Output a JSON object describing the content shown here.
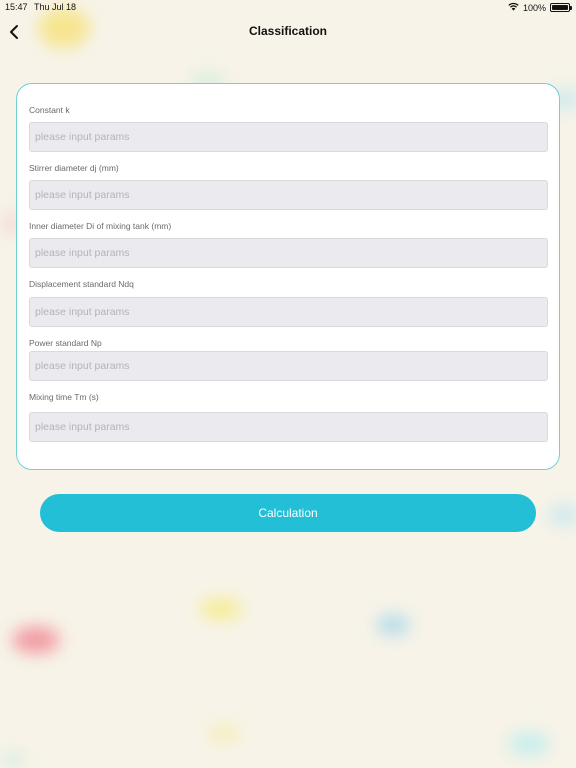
{
  "status_bar": {
    "time": "15:47",
    "date": "Thu Jul 18",
    "battery": "100%",
    "battery_level": 1.0
  },
  "nav": {
    "title": "Classification",
    "back_icon": "chevron-left-icon"
  },
  "form": {
    "fields": [
      {
        "label": "Constant k",
        "placeholder": "please input params",
        "value": ""
      },
      {
        "label": "Stirrer diameter dj (mm)",
        "placeholder": "please input params",
        "value": ""
      },
      {
        "label": "Inner diameter Di of mixing tank (mm)",
        "placeholder": "please input params",
        "value": ""
      },
      {
        "label": "Displacement standard Ndq",
        "placeholder": "please input params",
        "value": ""
      },
      {
        "label": "Power standard Np",
        "placeholder": "please input params",
        "value": ""
      },
      {
        "label": "Mixing time Tm (s)",
        "placeholder": "please input params",
        "value": ""
      }
    ],
    "submit_label": "Calculation"
  },
  "colors": {
    "accent": "#22bfd6",
    "card_border": "#6fd0d8",
    "background": "#f7f3e8",
    "input_bg": "#ebebef"
  }
}
